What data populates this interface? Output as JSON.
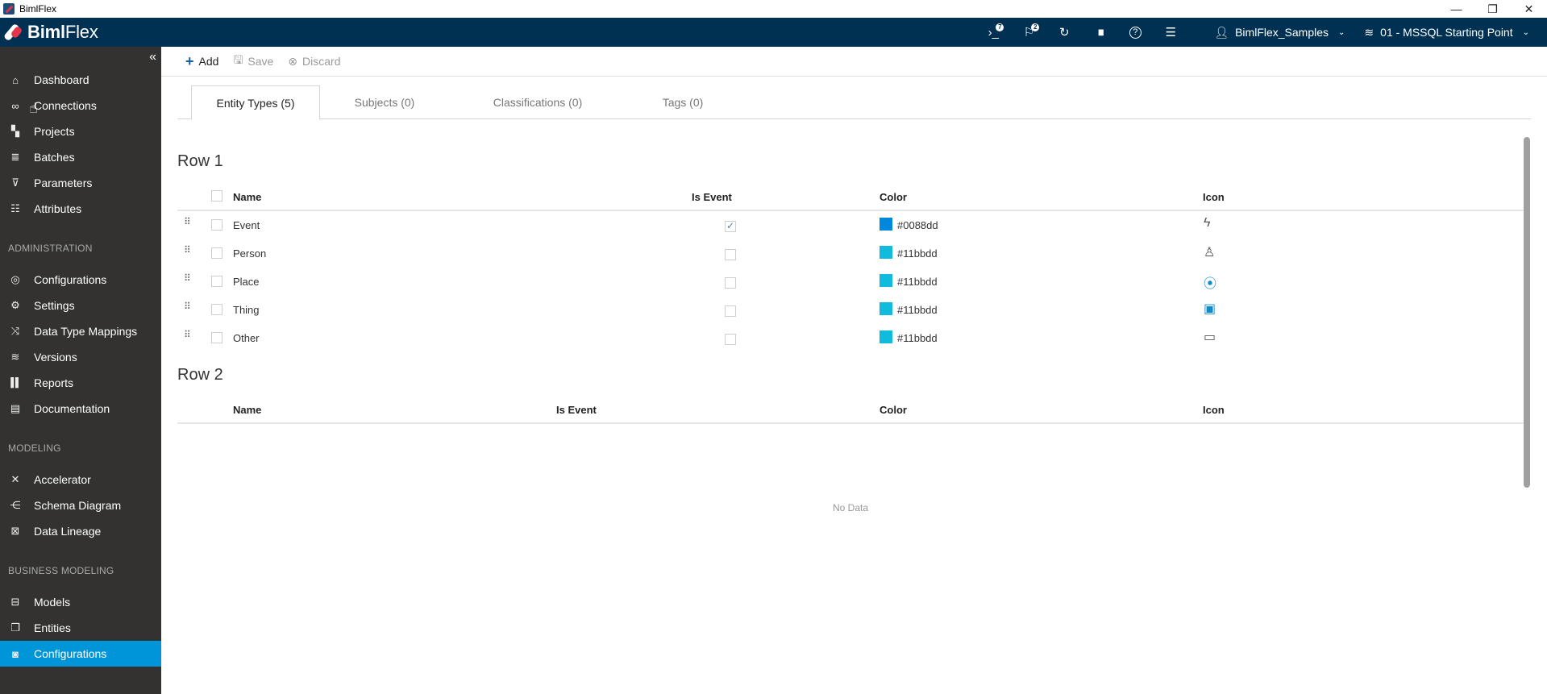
{
  "window": {
    "title": "BimlFlex",
    "controls": {
      "minimize": "—",
      "restore": "❐",
      "close": "✕"
    }
  },
  "header": {
    "logo_bold": "Biml",
    "logo_light": "Flex",
    "icons": [
      {
        "name": "console-icon",
        "glyph": "›_",
        "badge": "7"
      },
      {
        "name": "flag-icon",
        "glyph": "⚐",
        "badge": "2"
      },
      {
        "name": "refresh-icon",
        "glyph": "↻",
        "badge": null
      },
      {
        "name": "analytics-icon",
        "glyph": "▮▮",
        "badge": null
      },
      {
        "name": "help-icon",
        "glyph": "?",
        "badge": null
      },
      {
        "name": "server-icon",
        "glyph": "☰",
        "badge": null
      }
    ],
    "customer": {
      "icon": "user-icon",
      "label": "BimlFlex_Samples"
    },
    "version": {
      "icon": "layers-icon",
      "label": "01 - MSSQL Starting Point"
    }
  },
  "sidebar": {
    "collapse_glyph": "«",
    "sections": [
      {
        "label": ""
      },
      {
        "label": "ADMINISTRATION"
      },
      {
        "label": "MODELING"
      },
      {
        "label": "BUSINESS MODELING"
      }
    ],
    "items": [
      {
        "label": "Dashboard",
        "icon": "home-icon",
        "glyph": "⌂",
        "active": false
      },
      {
        "label": "Connections",
        "icon": "link-icon",
        "glyph": "🔗",
        "active": false
      },
      {
        "label": "Projects",
        "icon": "projects-icon",
        "glyph": "▚",
        "active": false
      },
      {
        "label": "Batches",
        "icon": "batches-icon",
        "glyph": "≣",
        "active": false
      },
      {
        "label": "Parameters",
        "icon": "parameters-icon",
        "glyph": "⊽",
        "active": false
      },
      {
        "label": "Attributes",
        "icon": "attributes-icon",
        "glyph": "☷",
        "active": false
      },
      {
        "label": "Configurations",
        "icon": "configurations-icon",
        "glyph": "◎",
        "active": false
      },
      {
        "label": "Settings",
        "icon": "settings-icon",
        "glyph": "⚙",
        "active": false
      },
      {
        "label": "Data Type Mappings",
        "icon": "shuffle-icon",
        "glyph": "⤨",
        "active": false
      },
      {
        "label": "Versions",
        "icon": "layers-icon",
        "glyph": "≋",
        "active": false
      },
      {
        "label": "Reports",
        "icon": "bar-chart-icon",
        "glyph": "▌",
        "active": false
      },
      {
        "label": "Documentation",
        "icon": "printer-icon",
        "glyph": "▤",
        "active": false
      },
      {
        "label": "Accelerator",
        "icon": "accelerator-icon",
        "glyph": "✕",
        "active": false
      },
      {
        "label": "Schema Diagram",
        "icon": "schema-diagram-icon",
        "glyph": "⋲",
        "active": false
      },
      {
        "label": "Data Lineage",
        "icon": "data-lineage-icon",
        "glyph": "⊠",
        "active": false
      },
      {
        "label": "Models",
        "icon": "models-icon",
        "glyph": "⊟",
        "active": false
      },
      {
        "label": "Entities",
        "icon": "entities-icon",
        "glyph": "❐",
        "active": false
      },
      {
        "label": "Configurations",
        "icon": "configurations-icon",
        "glyph": "◙",
        "active": true
      }
    ]
  },
  "toolbar": {
    "add_label": "Add",
    "save_label": "Save",
    "discard_label": "Discard"
  },
  "tabs": [
    {
      "label": "Entity Types (5)",
      "active": true
    },
    {
      "label": "Subjects (0)",
      "active": false
    },
    {
      "label": "Classifications (0)",
      "active": false
    },
    {
      "label": "Tags (0)",
      "active": false
    }
  ],
  "row1": {
    "title": "Row 1",
    "columns": [
      "Name",
      "Is Event",
      "Color",
      "Icon"
    ],
    "rows": [
      {
        "name": "Event",
        "is_event": true,
        "color": "#0088dd",
        "icon": "lightning-icon",
        "glyph": "⚡"
      },
      {
        "name": "Person",
        "is_event": false,
        "color": "#11bbdd",
        "icon": "person-icon",
        "glyph": "👤"
      },
      {
        "name": "Place",
        "is_event": false,
        "color": "#11bbdd",
        "icon": "map-pin-icon",
        "glyph": "📍"
      },
      {
        "name": "Thing",
        "is_event": false,
        "color": "#11bbdd",
        "icon": "calendar-icon",
        "glyph": "📅"
      },
      {
        "name": "Other",
        "is_event": false,
        "color": "#11bbdd",
        "icon": "chat-icon",
        "glyph": "💬"
      }
    ]
  },
  "row2": {
    "title": "Row 2",
    "columns": [
      "Name",
      "Is Event",
      "Color",
      "Icon"
    ],
    "empty_text": "No Data"
  }
}
